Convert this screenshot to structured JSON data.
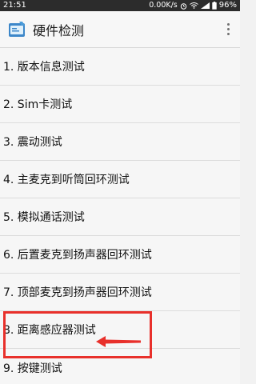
{
  "status_bar": {
    "time": "21:51",
    "net_speed": "0.00K/s",
    "battery": "96%"
  },
  "action_bar": {
    "title": "硬件检测",
    "app_icon": "hardware-check-icon",
    "menu_icon": "overflow-menu-icon"
  },
  "list": {
    "items": [
      {
        "label": "1. 版本信息测试"
      },
      {
        "label": "2. Sim卡测试"
      },
      {
        "label": "3. 震动测试"
      },
      {
        "label": "4. 主麦克到听筒回环测试"
      },
      {
        "label": "5. 模拟通话测试"
      },
      {
        "label": "6. 后置麦克到扬声器回环测试"
      },
      {
        "label": "7. 顶部麦克到扬声器回环测试"
      },
      {
        "label": "8. 距离感应器测试"
      },
      {
        "label": "9. 按键测试"
      }
    ]
  },
  "annotation": {
    "highlight_color": "#e8302b",
    "highlighted_item_index": 7
  }
}
